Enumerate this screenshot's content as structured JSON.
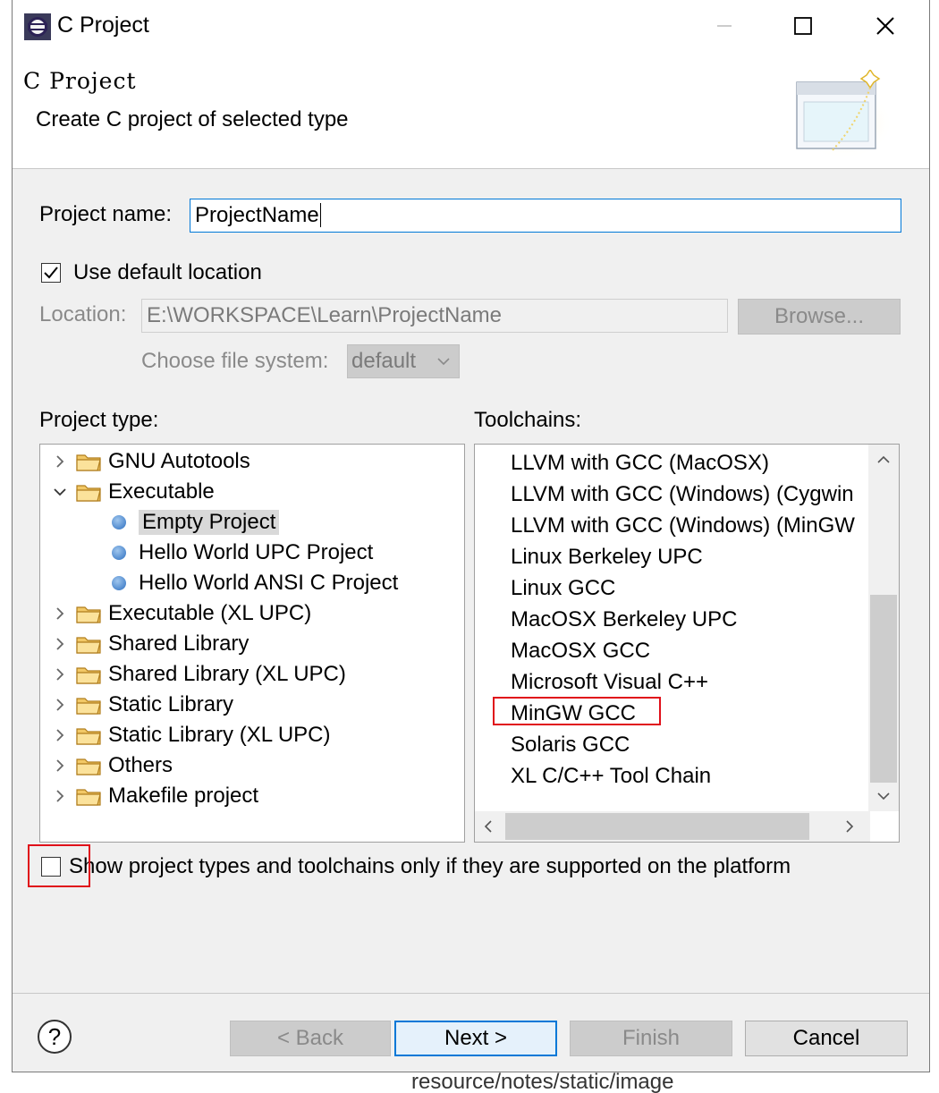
{
  "window": {
    "title": "C Project"
  },
  "banner": {
    "title": "C Project",
    "description": "Create C project of selected type"
  },
  "form": {
    "project_name_label": "Project name:",
    "project_name_value": "ProjectName",
    "use_default_location_label": "Use default location",
    "use_default_location_checked": true,
    "location_label": "Location:",
    "location_value": "E:\\WORKSPACE\\Learn\\ProjectName",
    "browse_label": "Browse...",
    "file_system_label": "Choose file system:",
    "file_system_value": "default"
  },
  "project_type": {
    "label": "Project type:",
    "items": [
      {
        "label": "GNU Autotools",
        "kind": "folder",
        "expanded": false
      },
      {
        "label": "Executable",
        "kind": "folder",
        "expanded": true
      },
      {
        "label": "Empty Project",
        "kind": "leaf",
        "selected": true
      },
      {
        "label": "Hello World UPC Project",
        "kind": "leaf"
      },
      {
        "label": "Hello World ANSI C Project",
        "kind": "leaf"
      },
      {
        "label": "Executable (XL UPC)",
        "kind": "folder",
        "expanded": false
      },
      {
        "label": "Shared Library",
        "kind": "folder",
        "expanded": false
      },
      {
        "label": "Shared Library (XL UPC)",
        "kind": "folder",
        "expanded": false
      },
      {
        "label": "Static Library",
        "kind": "folder",
        "expanded": false
      },
      {
        "label": "Static Library (XL UPC)",
        "kind": "folder",
        "expanded": false
      },
      {
        "label": "Others",
        "kind": "folder",
        "expanded": false
      },
      {
        "label": "Makefile project",
        "kind": "folder",
        "expanded": false
      }
    ]
  },
  "toolchains": {
    "label": "Toolchains:",
    "items": [
      "LLVM with GCC (MacOSX)",
      "LLVM with GCC (Windows) (Cygwin",
      "LLVM with GCC (Windows) (MinGW",
      "Linux Berkeley UPC",
      "Linux GCC",
      "MacOSX Berkeley UPC",
      "MacOSX GCC",
      "Microsoft Visual C++",
      "MinGW GCC",
      "Solaris GCC",
      "XL C/C++ Tool Chain"
    ],
    "highlighted": "MinGW GCC"
  },
  "filter": {
    "label": "Show project types and toolchains only if they are supported on the platform",
    "checked": false
  },
  "buttons": {
    "help": "?",
    "back": "< Back",
    "next": "Next >",
    "finish": "Finish",
    "cancel": "Cancel"
  },
  "background": {
    "bottom_path": "resource/notes/static/image"
  },
  "colors": {
    "accent": "#0078d7",
    "highlight_box": "#e0101a",
    "selection": "#d9d9d9"
  }
}
